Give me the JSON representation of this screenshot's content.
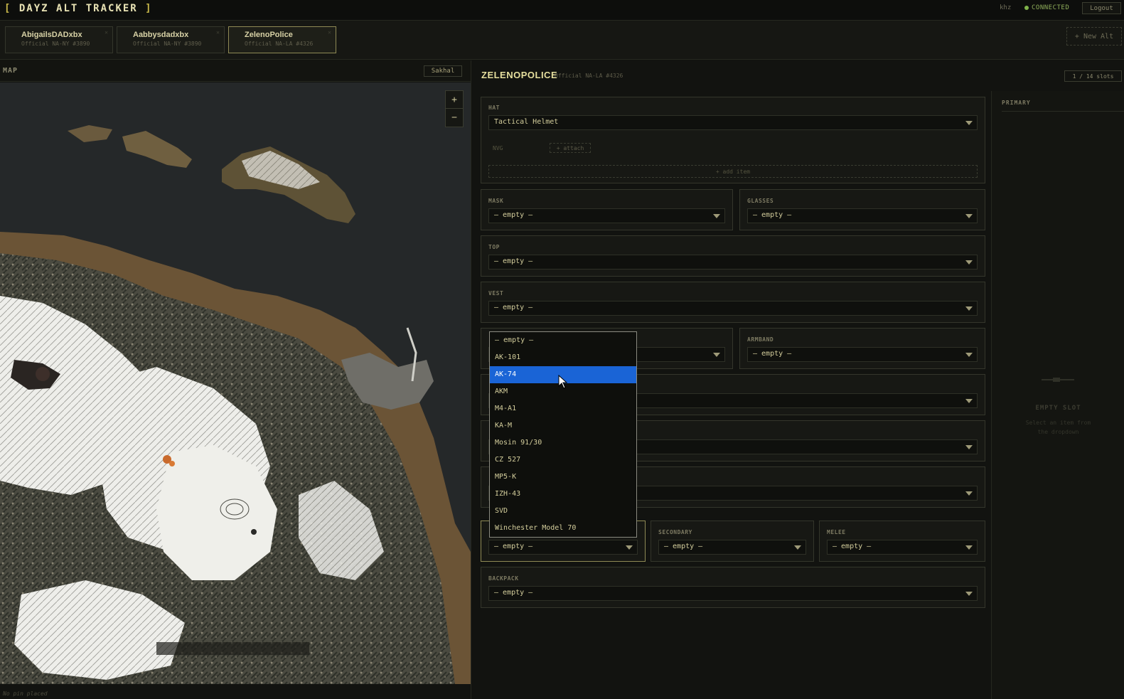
{
  "app": {
    "title": "DAYZ ALT TRACKER",
    "bracket_open": "[",
    "bracket_close": "]",
    "user": "khz",
    "status": "CONNECTED",
    "logout": "Logout"
  },
  "tabs": [
    {
      "name": "AbigailsDADxbx",
      "server": "Official NA-NY #3890"
    },
    {
      "name": "Aabbysdadxbx",
      "server": "Official NA-NY #3890"
    },
    {
      "name": "ZelenoPolice",
      "server": "Official NA-LA #4326"
    }
  ],
  "new_alt": "+ New Alt",
  "map": {
    "label": "MAP",
    "name": "Sakhal",
    "zoom_in": "+",
    "zoom_out": "−",
    "no_pin": "No pin placed"
  },
  "character": {
    "name": "ZELENOPOLICE",
    "server": "Official NA-LA #4326",
    "slots": "1 / 14 slots"
  },
  "slots": {
    "hat": {
      "label": "HAT",
      "value": "Tactical Helmet"
    },
    "nvg": {
      "label": "NVG",
      "attach": "+ attach"
    },
    "add_item": "+ add item",
    "mask": {
      "label": "MASK",
      "value": "— empty —"
    },
    "glasses": {
      "label": "GLASSES",
      "value": "— empty —"
    },
    "top": {
      "label": "TOP",
      "value": "— empty —"
    },
    "vest": {
      "label": "VEST",
      "value": "— empty —"
    },
    "armband": {
      "label": "ARMBAND",
      "value": "— empty —"
    },
    "primary": {
      "value": "— empty —"
    },
    "secondary": {
      "label": "SECONDARY",
      "value": "— empty —"
    },
    "melee": {
      "label": "MELEE",
      "value": "— empty —"
    },
    "backpack": {
      "label": "BACKPACK",
      "value": "— empty —"
    }
  },
  "dropdown": {
    "options": [
      "— empty —",
      "AK-101",
      "AK-74",
      "AKM",
      "M4-A1",
      "KA-M",
      "Mosin 91/30",
      "CZ 527",
      "MP5-K",
      "IZH-43",
      "SVD",
      "Winchester Model 70"
    ],
    "highlighted": "AK-74"
  },
  "detail": {
    "label": "PRIMARY",
    "empty_title": "EMPTY SLOT",
    "empty_hint": "Select an item from the dropdown"
  },
  "colors": {
    "accent": "#c8b84a",
    "status": "#7fb34a",
    "highlight": "#1a64d6"
  }
}
